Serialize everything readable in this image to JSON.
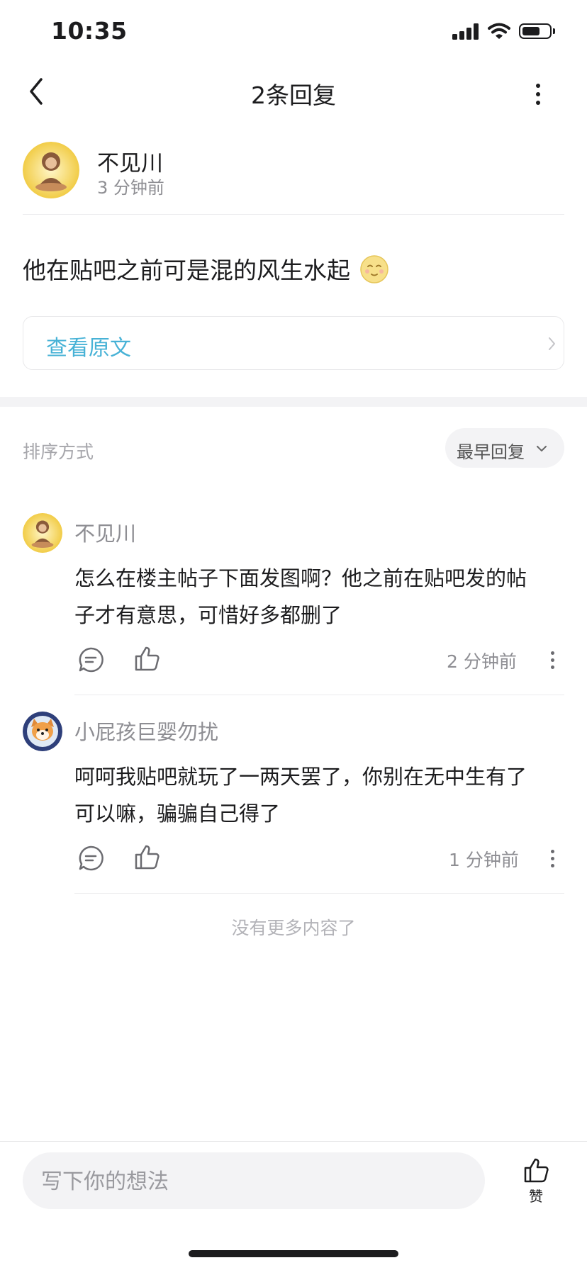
{
  "status_bar": {
    "time": "10:35"
  },
  "nav": {
    "title": "2条回复"
  },
  "original_post": {
    "author": "不见川",
    "time": "3 分钟前",
    "content": "他在贴吧之前可是混的风生水起",
    "view_original": "查看原文"
  },
  "sort": {
    "label": "排序方式",
    "value": "最早回复"
  },
  "replies": [
    {
      "author": "不见川",
      "line1": "怎么在楼主帖子下面发图啊？他之前在贴吧发的帖",
      "line2": "子才有意思，可惜好多都删了",
      "time": "2 分钟前"
    },
    {
      "author": "小屁孩巨婴勿扰",
      "line1": "呵呵我贴吧就玩了一两天罢了，你别在无中生有了",
      "line2": "可以嘛，骗骗自己得了",
      "time": "1 分钟前"
    }
  ],
  "footer_note": "没有更多内容了",
  "bottom_bar": {
    "input_placeholder": "写下你的想法",
    "like_label": "赞"
  },
  "colors": {
    "link": "#47b2d6",
    "muted_text": "#8e8e93",
    "band": "#f3f3f5"
  }
}
